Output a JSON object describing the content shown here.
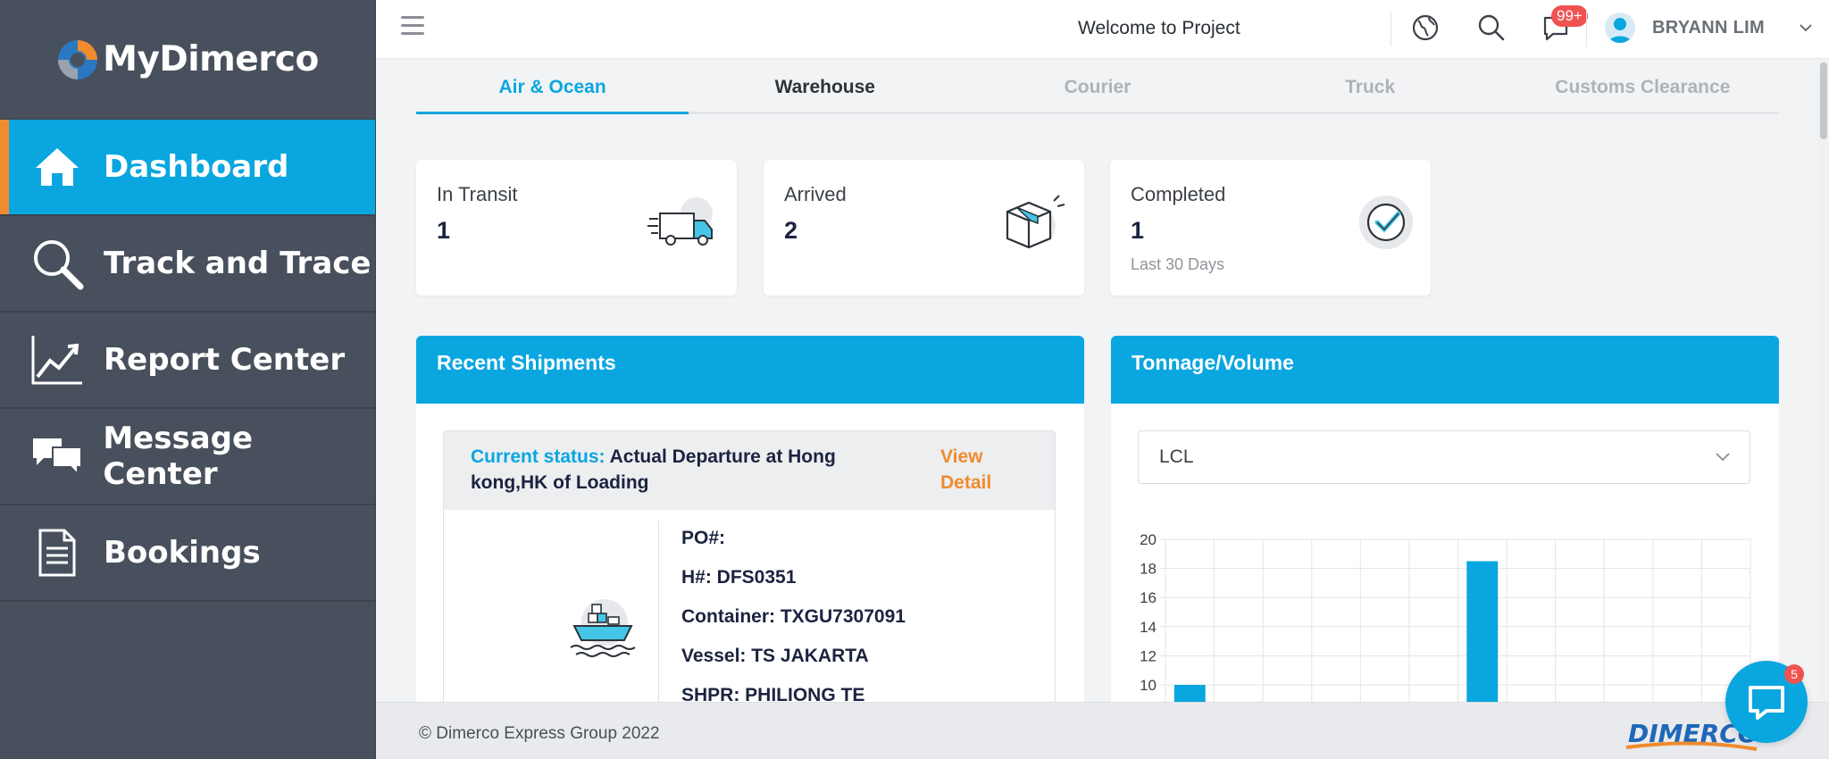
{
  "app": {
    "brand": "MyDimerco"
  },
  "sidebar": {
    "items": [
      {
        "label": "Dashboard",
        "icon": "home-icon"
      },
      {
        "label": "Track and Trace",
        "icon": "search-icon"
      },
      {
        "label": "Report Center",
        "icon": "chart-icon"
      },
      {
        "label": "Message Center",
        "icon": "messages-icon"
      },
      {
        "label": "Bookings",
        "icon": "document-icon"
      }
    ]
  },
  "topbar": {
    "welcome": "Welcome to Project",
    "notification_badge": "99+",
    "user_name": "BRYANN LIM"
  },
  "tabs": [
    {
      "label": "Air & Ocean"
    },
    {
      "label": "Warehouse"
    },
    {
      "label": "Courier"
    },
    {
      "label": "Truck"
    },
    {
      "label": "Customs Clearance"
    }
  ],
  "stats": {
    "in_transit": {
      "label": "In Transit",
      "value": "1"
    },
    "arrived": {
      "label": "Arrived",
      "value": "2"
    },
    "completed": {
      "label": "Completed",
      "value": "1",
      "sub": "Last 30 Days"
    }
  },
  "recent_shipments": {
    "title": "Recent Shipments",
    "status_key": "Current status:",
    "status_value": "Actual Departure at Hong kong,HK of Loading",
    "view_detail": "View Detail",
    "po": "PO#:",
    "hbl": "H#: DFS0351",
    "container": "Container: TXGU7307091",
    "vessel": "Vessel: TS JAKARTA",
    "partial_line": "SHPR: PHILIONG TE"
  },
  "tonnage": {
    "title": "Tonnage/Volume",
    "select_value": "LCL"
  },
  "chart_data": {
    "type": "bar",
    "y_ticks": [
      10,
      12,
      14,
      16,
      18,
      20
    ],
    "ylim": [
      8,
      20
    ],
    "grid": true,
    "columns": 12,
    "values": [
      10,
      null,
      null,
      null,
      null,
      null,
      18.5,
      null,
      null,
      null,
      null,
      null
    ],
    "bar_color": "#0aa6e0"
  },
  "footer": {
    "copyright": "© Dimerco Express Group 2022",
    "logo_text": "DIMERCO"
  },
  "chat": {
    "badge": "5"
  },
  "colors": {
    "accent": "#0aa6e0",
    "sidebar": "#47505c",
    "active_marker": "#f28a2e",
    "badge": "#f0524f"
  }
}
